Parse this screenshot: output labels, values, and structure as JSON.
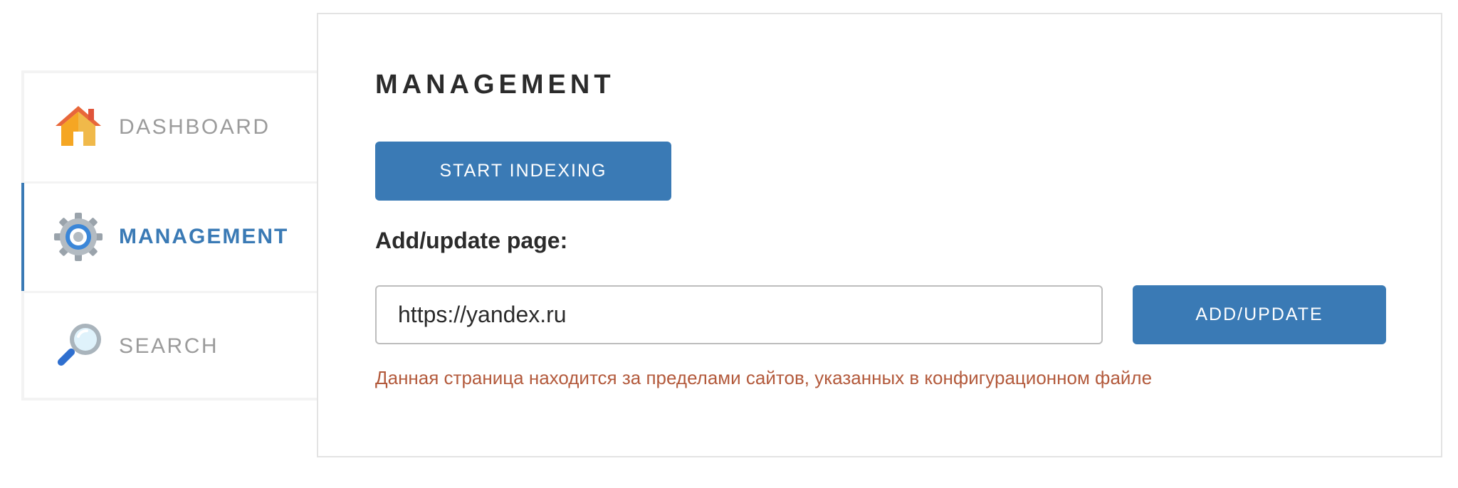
{
  "sidebar": {
    "items": [
      {
        "label": "DASHBOARD",
        "icon": "house-icon",
        "active": false
      },
      {
        "label": "MANAGEMENT",
        "icon": "gear-icon",
        "active": true
      },
      {
        "label": "SEARCH",
        "icon": "magnifier-icon",
        "active": false
      }
    ]
  },
  "main": {
    "title": "MANAGEMENT",
    "start_button": "START INDEXING",
    "add_section_label": "Add/update page:",
    "url_input_value": "https://yandex.ru",
    "add_button": "ADD/UPDATE",
    "error_message": "Данная страница находится за пределами сайтов, указанных в конфигурационном файле"
  },
  "colors": {
    "accent": "#3a7ab5",
    "error": "#b35a3c",
    "inactive_text": "#9b9b9b"
  }
}
